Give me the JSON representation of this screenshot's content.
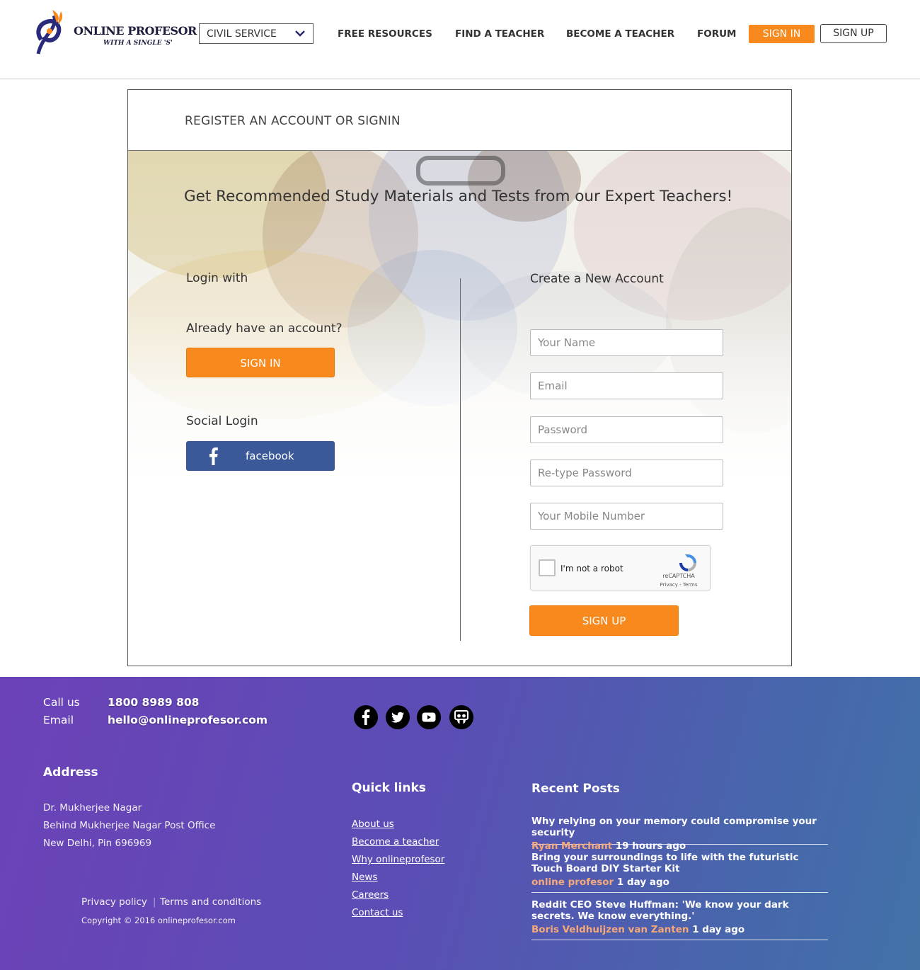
{
  "header": {
    "logo_title": "ONLINE PROFESOR",
    "logo_tagline": "WITH A SINGLE 'S'",
    "exam_selector": "CIVIL SERVICE",
    "nav": [
      "FREE RESOURCES",
      "FIND A TEACHER",
      "BECOME A TEACHER",
      "FORUM"
    ],
    "signin_label": "SIGN IN",
    "signup_label": "SIGN UP",
    "accent_color": "#f7891d"
  },
  "panel": {
    "title": "REGISTER AN ACCOUNT OR SIGNIN",
    "tagline": "Get Recommended Study Materials and Tests from our Expert Teachers!",
    "login": {
      "heading": "Login with",
      "already": "Already have  an account?",
      "signin_button": "SIGN IN",
      "social_heading": "Social Login",
      "facebook_label": "facebook",
      "facebook_color": "#3b5998"
    },
    "register": {
      "heading": "Create a New Account",
      "fields": {
        "name": "Your Name",
        "email": "Email",
        "password": "Password",
        "retype": "Re-type Password",
        "mobile": "Your Mobile Number"
      },
      "captcha_label": "I'm not a robot",
      "captcha_brand": "reCAPTCHA",
      "captcha_links": "Privacy - Terms",
      "signup_button": "SIGN UP"
    }
  },
  "footer": {
    "call_label": "Call us",
    "phone": "1800 8989 808",
    "email_label": "Email",
    "email": "hello@onlineprofesor.com",
    "social_icons": [
      "facebook-icon",
      "twitter-icon",
      "youtube-icon",
      "slideshare-icon"
    ],
    "address_heading": "Address",
    "address": [
      "Dr. Mukherjee Nagar",
      "Behind Mukherjee Nagar Post Office",
      "New Delhi, Pin 696969"
    ],
    "privacy": "Privacy policy",
    "terms": "Terms and conditions",
    "copyright": "Copyright © 2016 onlineprofesor.com",
    "quick_links_heading": "Quick links",
    "quick_links": [
      "About us",
      "Become a teacher ",
      "Why onlineprofesor",
      "News ",
      "Careers ",
      "Contact us"
    ],
    "recent_posts_heading": "Recent Posts",
    "posts": [
      {
        "title": "Why relying on your memory could compromise your security",
        "author": "Ryan Merchant",
        "time": " 19 hours ago"
      },
      {
        "title": "Bring your surroundings to life with the futuristic Touch Board DIY Starter Kit",
        "author": "online profesor",
        "time": " 1 day ago"
      },
      {
        "title": "Reddit CEO Steve Huffman: 'We know your dark secrets. We know everything.'",
        "author": "Boris Veldhuijzen van Zanten",
        "time": " 1 day ago"
      }
    ]
  }
}
